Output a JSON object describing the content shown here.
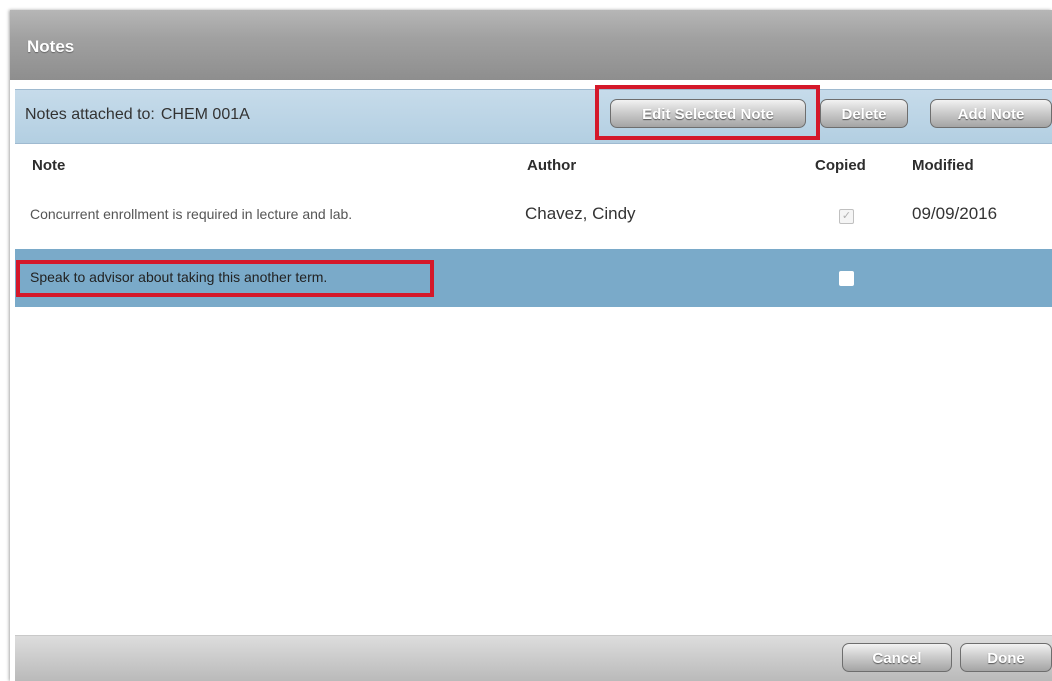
{
  "dialog": {
    "title": "Notes"
  },
  "attach": {
    "label": "Notes attached to:",
    "course": "CHEM 001A"
  },
  "buttons": {
    "edit": "Edit Selected Note",
    "delete": "Delete",
    "add": "Add Note",
    "cancel": "Cancel",
    "done": "Done"
  },
  "table": {
    "columns": [
      "Note",
      "Author",
      "Copied",
      "Modified"
    ],
    "rows": [
      {
        "note": "Concurrent enrollment is required in lecture and lab.",
        "author": "Chavez, Cindy",
        "copied": true,
        "modified": "09/09/2016",
        "selected": false
      },
      {
        "note": "Speak to advisor about taking this another term.",
        "author": "",
        "copied": false,
        "modified": "",
        "selected": true
      }
    ]
  },
  "colors": {
    "selected_row": "#7aaac9",
    "attach_bar": "#b3cfe2",
    "highlight": "#d4182a"
  }
}
